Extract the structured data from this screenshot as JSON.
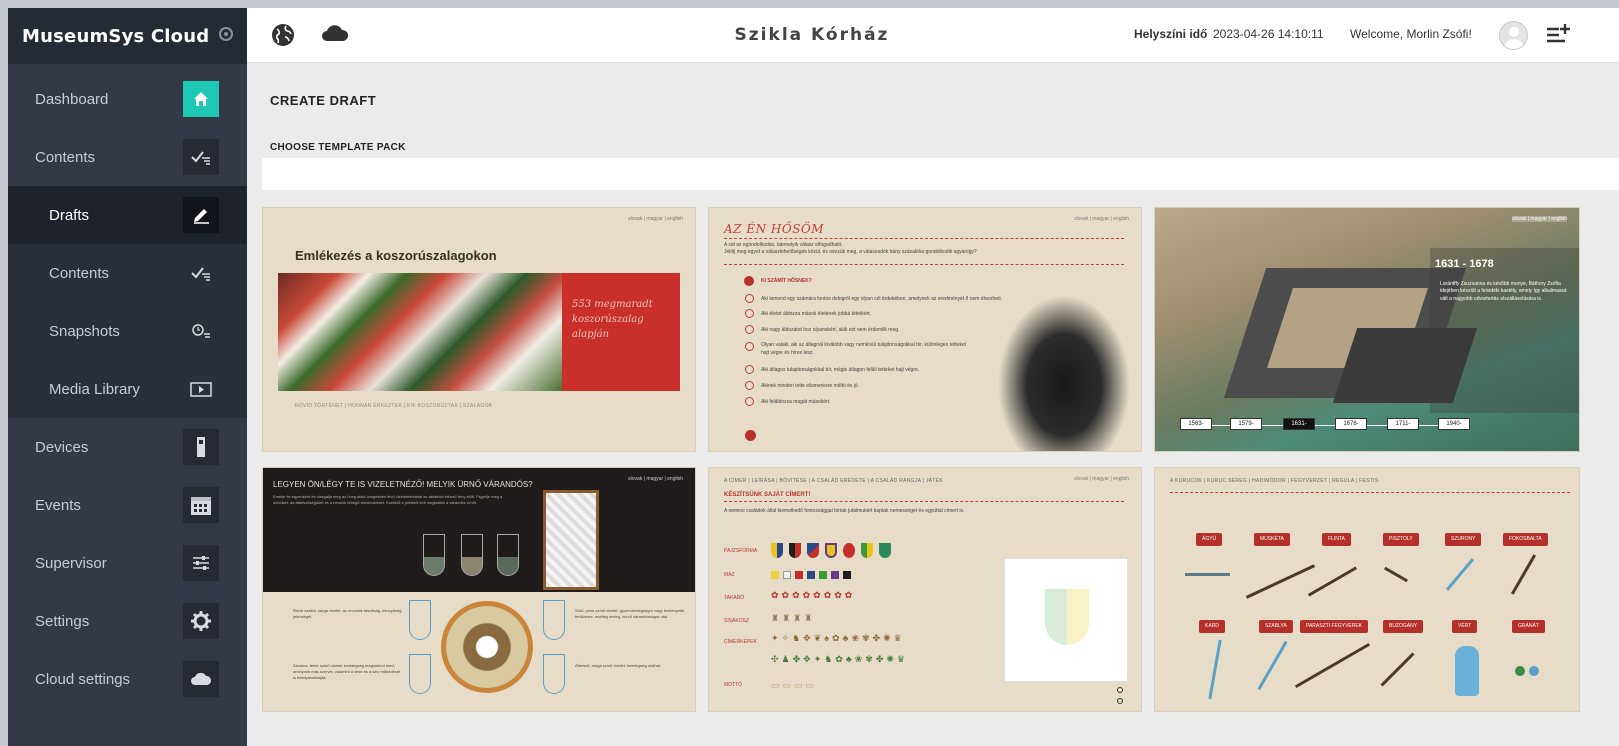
{
  "sidebar": {
    "brand": "MuseumSys Cloud",
    "items": [
      {
        "label": "Dashboard",
        "icon": "home-icon"
      },
      {
        "label": "Contents",
        "icon": "checklist-icon"
      },
      {
        "label": "Drafts",
        "icon": "edit-icon"
      },
      {
        "label": "Contents",
        "icon": "checklist-icon"
      },
      {
        "label": "Snapshots",
        "icon": "snapshot-icon"
      },
      {
        "label": "Media Library",
        "icon": "play-icon"
      },
      {
        "label": "Devices",
        "icon": "device-icon"
      },
      {
        "label": "Events",
        "icon": "calendar-icon"
      },
      {
        "label": "Supervisor",
        "icon": "sliders-icon"
      },
      {
        "label": "Settings",
        "icon": "gear-icon"
      },
      {
        "label": "Cloud settings",
        "icon": "cloud-icon"
      }
    ]
  },
  "header": {
    "site_title": "Szikla Kórház",
    "local_time_label": "Helyszíni idő",
    "local_time_value": "2023-04-26 14:10:11",
    "welcome": "Welcome, Morlin Zsófi!"
  },
  "main": {
    "page_title": "CREATE DRAFT",
    "section_title": "CHOOSE TEMPLATE PACK"
  },
  "templates": {
    "lang_switch": "slovak | magyar | english",
    "card1": {
      "title": "Emlékezés a koszorúszalagokon",
      "red_text": "553 megmaradt koszorúszalag alapján",
      "links": "RÖVID TÖRTÉNET  |  HONNAN ÉRKEZTEK  |  KIK KOSZORÚZTAK  |  SZALAGOK"
    },
    "card2": {
      "title": "AZ ÉN HŐSÖM",
      "intro1": "A cél az egondolkodás, bármelyik válasz elfogadható.",
      "intro2": "Jelölj meg egyet a válaszlehetőségek közül, és nézzük meg, a válaszadók hány százaléka gondolkodik ugyanígy?",
      "question": "KI SZÁMÍT HŐSNEK?",
      "options": [
        "Aki lemond egy számára fontos dologról egy olyan cél érdekében, amelynek az eredményét ő nem élvezheti.",
        "Aki életet áldozza mások életének jobbá tételéért.",
        "Aki nagy áldozatot hoz olyanokért, akik ezt nem érdemlik meg.",
        "Olyan valaki, aki az átlagnál kiválóbb vagy nemkívül tulajdonságokkal bír, különleges tetteket hajt végre és híres lesz.",
        "Aki átlagos tulajdonságokkal bír, mégis átlagon felüli tetteket hajt végre.",
        "Akinek minden tette elismerésre méltó és jó.",
        "Aki feláldozza magát másokért."
      ]
    },
    "card3": {
      "years": "1631 - 1678",
      "text": "Lorántffy Zsuzsanna és később menye, Báthory Zsófia idejében készült a felvidéki kastély, amely így alkalmassá vált a nagyobb udvartartás elszállásolására is.",
      "timeline": [
        "1563-",
        "1579-",
        "1631-",
        "1678-",
        "1711-",
        "1940-"
      ]
    },
    "card4": {
      "title": "LEGYEN ÖN/LÉGY TE IS VIZELETNÉZŐ! MELYIK ÜRNŐ VÁRANDÓS?",
      "text": "Emelje fel egyenként és vizsgálja meg az üveg alatti üvegekben lévő vizeletmintákat az ablakból érkező fény előtt. Figyelje meg a színüket, az áttetszőségüket és a bennük lebegő részecskéket. Ezekből a jelekből kell megtalálni a várandós úrnőt.",
      "left_note": "Rövid száltól, sárga vizelet: az orvoslók fásultság, könnyűség jelenségét.",
      "right_note": "Sűrű, piros színű vizelet: gyomorbetegségre vagy keményebb fertőzésre, esetleg meleg, vérző várandósságra utal.",
      "left_note2": "Zavaros, fehér színű vizelet: betetegség magunkból ered, amelynek más szervei, valamint a vese és a szív működését is befolyásolhatják.",
      "right_note2": "Áttetsző, sárga színű vizelet: betetegség utalhat."
    },
    "card5": {
      "tabs": "A CÍMER  |  LEÍRÁSA  |  BŐVÍTÉSE  |  A CSALÁD EREDETE  |  A CSALÁD RANGJA  |  JÁTÉK",
      "subtitle": "KÉSZÍTSÜNK SAJÁT CÍMERT!",
      "intro": "A nemesi családok által kiemelkedő fontossággal bírtak jutalmukért kaptak nemességet és egyúttal címert is.",
      "rows": [
        "PAJZSFORMA",
        "MÁZ",
        "TAKARÓ",
        "SISAKOSZ",
        "CÍMERKÉPEK",
        "MOTTÓ"
      ]
    },
    "card6": {
      "tabs": "A KURUCOK  |  KURUC SEREG  |  HADIMÓDOR  |  FEGYVERZET  |  REGULA  |  FESTIS",
      "weapons_top": [
        "ÁGYÚ",
        "MUSKÉTA",
        "FLINTA",
        "PISZTOLY",
        "SZURONY",
        "FOKOSBALTA"
      ],
      "weapons_bottom": [
        "KARD",
        "SZABLYA",
        "PARASZTI FEGYVEREK",
        "BUZOGÁNY",
        "VÉRT",
        "GRÁNÁT"
      ]
    }
  }
}
